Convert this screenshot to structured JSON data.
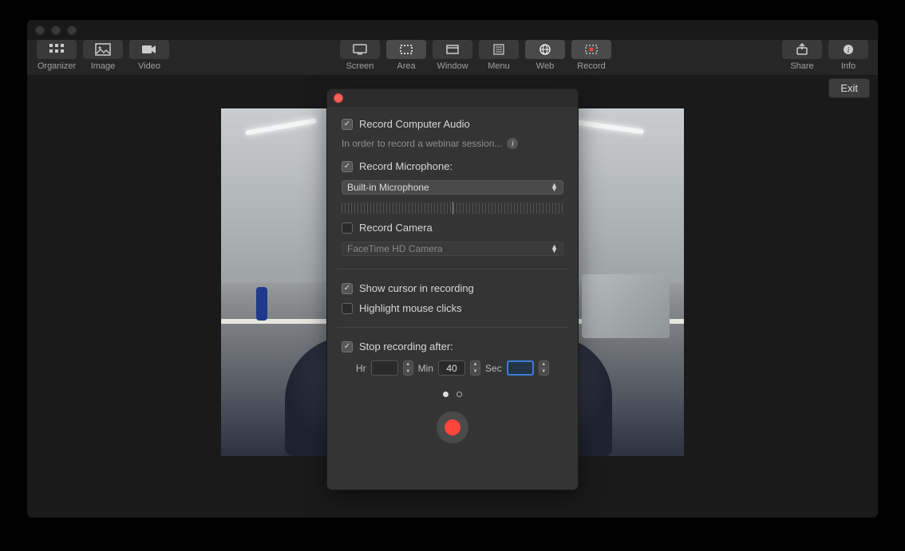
{
  "toolbar": {
    "left": [
      {
        "label": "Organizer",
        "icon": "grid"
      },
      {
        "label": "Image",
        "icon": "image"
      },
      {
        "label": "Video",
        "icon": "video"
      }
    ],
    "center": [
      {
        "label": "Screen",
        "icon": "screen"
      },
      {
        "label": "Area",
        "icon": "area",
        "selected": true
      },
      {
        "label": "Window",
        "icon": "window"
      },
      {
        "label": "Menu",
        "icon": "menu"
      },
      {
        "label": "Web",
        "icon": "web",
        "selected": true
      },
      {
        "label": "Record",
        "icon": "record",
        "selected": true
      }
    ],
    "right": [
      {
        "label": "Share",
        "icon": "share"
      },
      {
        "label": "Info",
        "icon": "info"
      }
    ]
  },
  "exit_label": "Exit",
  "panel": {
    "record_audio_label": "Record Computer Audio",
    "record_audio_checked": true,
    "subtext": "In order to record a webinar session...",
    "record_mic_label": "Record Microphone:",
    "record_mic_checked": true,
    "mic_select_value": "Built-in Microphone",
    "record_camera_label": "Record Camera",
    "record_camera_checked": false,
    "camera_select_value": "FaceTime HD Camera",
    "show_cursor_label": "Show cursor in recording",
    "show_cursor_checked": true,
    "highlight_clicks_label": "Highlight mouse clicks",
    "highlight_clicks_checked": false,
    "stop_after_label": "Stop recording after:",
    "stop_after_checked": true,
    "hr_label": "Hr",
    "hr_value": "",
    "min_label": "Min",
    "min_value": "40",
    "sec_label": "Sec",
    "sec_value": ""
  }
}
